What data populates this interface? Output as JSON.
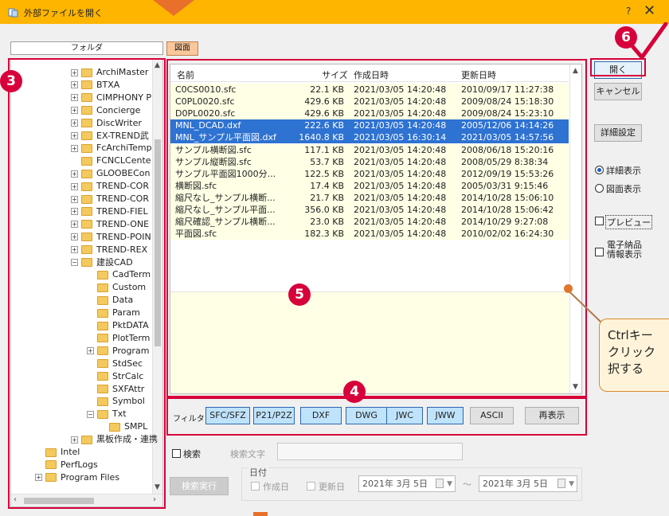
{
  "window": {
    "title": "外部ファイルを開く",
    "help": "?",
    "close": "✕"
  },
  "tree": {
    "header": "フォルダ",
    "items": [
      {
        "label": "ArchiMaster",
        "depth": 1,
        "exp": "+"
      },
      {
        "label": "BTXA",
        "depth": 1,
        "exp": "+"
      },
      {
        "label": "CIMPHONY P",
        "depth": 1,
        "exp": "+"
      },
      {
        "label": "Concierge",
        "depth": 1,
        "exp": "+"
      },
      {
        "label": "DiscWriter",
        "depth": 1,
        "exp": "+"
      },
      {
        "label": "EX-TREND武",
        "depth": 1,
        "exp": "+"
      },
      {
        "label": "FcArchiTemp",
        "depth": 1,
        "exp": "+"
      },
      {
        "label": "FCNCLCente",
        "depth": 1,
        "exp": ""
      },
      {
        "label": "GLOOBECon",
        "depth": 1,
        "exp": "+"
      },
      {
        "label": "TREND-COR",
        "depth": 1,
        "exp": "+"
      },
      {
        "label": "TREND-COR",
        "depth": 1,
        "exp": "+"
      },
      {
        "label": "TREND-FIEL",
        "depth": 1,
        "exp": "+"
      },
      {
        "label": "TREND-ONE",
        "depth": 1,
        "exp": "+"
      },
      {
        "label": "TREND-POIN",
        "depth": 1,
        "exp": "+"
      },
      {
        "label": "TREND-REX",
        "depth": 1,
        "exp": "+"
      },
      {
        "label": "建設CAD",
        "depth": 1,
        "exp": "−"
      },
      {
        "label": "CadTerm",
        "depth": 2,
        "exp": ""
      },
      {
        "label": "Custom",
        "depth": 2,
        "exp": ""
      },
      {
        "label": "Data",
        "depth": 2,
        "exp": ""
      },
      {
        "label": "Param",
        "depth": 2,
        "exp": ""
      },
      {
        "label": "PktDATA",
        "depth": 2,
        "exp": ""
      },
      {
        "label": "PlotTerm",
        "depth": 2,
        "exp": ""
      },
      {
        "label": "Program",
        "depth": 2,
        "exp": "+"
      },
      {
        "label": "StdSec",
        "depth": 2,
        "exp": ""
      },
      {
        "label": "StrCalc",
        "depth": 2,
        "exp": ""
      },
      {
        "label": "SXFAttr",
        "depth": 2,
        "exp": ""
      },
      {
        "label": "Symbol",
        "depth": 2,
        "exp": ""
      },
      {
        "label": "Txt",
        "depth": 2,
        "exp": "−"
      },
      {
        "label": "SMPL",
        "depth": 3,
        "exp": ""
      },
      {
        "label": "黒板作成・連携",
        "depth": 1,
        "exp": "+"
      },
      {
        "label": "Intel",
        "depth": 0,
        "exp": ""
      },
      {
        "label": "PerfLogs",
        "depth": 0,
        "exp": ""
      },
      {
        "label": "Program Files",
        "depth": 0,
        "exp": "+"
      }
    ]
  },
  "tab": {
    "label": "図面"
  },
  "filelist": {
    "columns": {
      "name": "名前",
      "size": "サイズ",
      "created": "作成日時",
      "modified": "更新日時"
    },
    "rows": [
      {
        "name": "C0CS0010.sfc",
        "size": "22.1 KB",
        "created": "2021/03/05 14:20:48",
        "modified": "2010/09/17 11:27:38",
        "selected": false
      },
      {
        "name": "C0PL0020.sfc",
        "size": "429.6 KB",
        "created": "2021/03/05 14:20:48",
        "modified": "2009/08/24 15:18:30",
        "selected": false
      },
      {
        "name": "D0PL0020.sfc",
        "size": "429.6 KB",
        "created": "2021/03/05 14:20:48",
        "modified": "2009/08/24 15:23:10",
        "selected": false
      },
      {
        "name": "MNL_DCAD.dxf",
        "size": "222.6 KB",
        "created": "2021/03/05 14:20:48",
        "modified": "2005/12/06 14:14:26",
        "selected": true
      },
      {
        "name": "MNL_サンプル平面図.dxf",
        "size": "1640.8 KB",
        "created": "2021/03/05 16:30:14",
        "modified": "2021/03/05 14:57:56",
        "selected": true
      },
      {
        "name": "サンプル横断図.sfc",
        "size": "117.1 KB",
        "created": "2021/03/05 14:20:48",
        "modified": "2008/06/18 15:20:16",
        "selected": false
      },
      {
        "name": "サンプル縦断図.sfc",
        "size": "53.7 KB",
        "created": "2021/03/05 14:20:48",
        "modified": "2008/05/29 8:38:34",
        "selected": false
      },
      {
        "name": "サンプル平面図1000分...",
        "size": "122.5 KB",
        "created": "2021/03/05 14:20:48",
        "modified": "2012/09/19 15:53:26",
        "selected": false
      },
      {
        "name": "横断図.sfc",
        "size": "17.4 KB",
        "created": "2021/03/05 14:20:48",
        "modified": "2005/03/31 9:15:46",
        "selected": false
      },
      {
        "name": "縮尺なし_サンプル横断...",
        "size": "21.7 KB",
        "created": "2021/03/05 14:20:48",
        "modified": "2014/10/28 15:06:10",
        "selected": false
      },
      {
        "name": "縮尺なし_サンプル平面...",
        "size": "356.0 KB",
        "created": "2021/03/05 14:20:48",
        "modified": "2014/10/28 15:06:42",
        "selected": false
      },
      {
        "name": "縮尺確認_サンプル横断...",
        "size": "23.0 KB",
        "created": "2021/03/05 14:20:48",
        "modified": "2014/10/29 9:27:08",
        "selected": false
      },
      {
        "name": "平面図.sfc",
        "size": "182.3 KB",
        "created": "2021/03/05 14:20:48",
        "modified": "2010/02/02 16:24:30",
        "selected": false
      }
    ]
  },
  "filter": {
    "label": "フィルタ",
    "buttons": [
      "SFC/SFZ",
      "P21/P2Z",
      "DXF",
      "DWG",
      "JWC",
      "JWW",
      "ASCII"
    ],
    "redisplay": "再表示"
  },
  "search": {
    "checkbox_label": "検索",
    "keyword_label": "検索文字",
    "execute": "検索実行",
    "date_group": "日付",
    "created_label": "作成日",
    "modified_label": "更新日",
    "date_from": "2021年  3月  5日",
    "date_to": "2021年  3月  5日",
    "tilde": "～"
  },
  "right_panel": {
    "open": "開く",
    "cancel": "キャンセル",
    "advanced": "詳細設定",
    "radio_detail": "詳細表示",
    "radio_drawing": "図面表示",
    "preview": "プレビュー",
    "denshi_line1": "電子納品",
    "denshi_line2": "情報表示"
  },
  "annotations": {
    "badge3": "3",
    "badge4": "4",
    "badge5": "5",
    "badge6": "6",
    "callout_line1": "Ctrlキー",
    "callout_line2": "クリック",
    "callout_line3": "択する"
  },
  "colors": {
    "titlebar": "#fdb500",
    "accent_red": "#d7003a",
    "selection": "#2e72d2",
    "row_bg": "#ffffe5",
    "filter_on": "#bfe3fb"
  }
}
